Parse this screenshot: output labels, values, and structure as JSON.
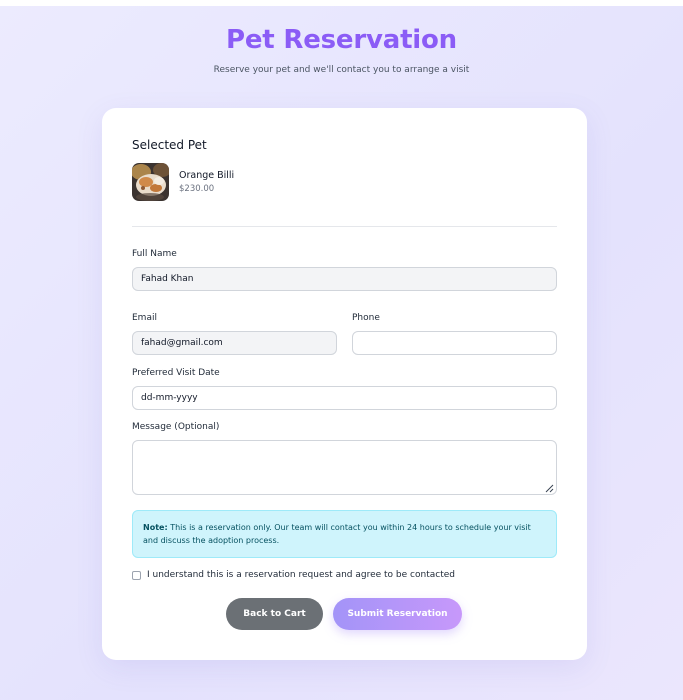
{
  "header": {
    "title": "Pet Reservation",
    "subtitle": "Reserve your pet and we'll contact you to arrange a visit"
  },
  "selected_pet": {
    "section_title": "Selected Pet",
    "name": "Orange Billi",
    "price": "$230.00"
  },
  "form": {
    "full_name": {
      "label": "Full Name",
      "value": "Fahad Khan"
    },
    "email": {
      "label": "Email",
      "value": "fahad@gmail.com"
    },
    "phone": {
      "label": "Phone",
      "value": ""
    },
    "visit_date": {
      "label": "Preferred Visit Date",
      "value": "dd-mm-yyyy"
    },
    "message": {
      "label": "Message (Optional)",
      "value": ""
    }
  },
  "note": {
    "prefix": "Note:",
    "text": "This is a reservation only. Our team will contact you within 24 hours to schedule your visit and discuss the adoption process."
  },
  "agreement": {
    "label": "I understand this is a reservation request and agree to be contacted",
    "checked": false
  },
  "actions": {
    "back_label": "Back to Cart",
    "submit_label": "Submit Reservation"
  },
  "colors": {
    "accent": "#8b5cf6",
    "note_bg": "#cff4fc",
    "back_button": "#6b7075",
    "submit_gradient_start": "#a394f8",
    "submit_gradient_end": "#c798fa"
  }
}
